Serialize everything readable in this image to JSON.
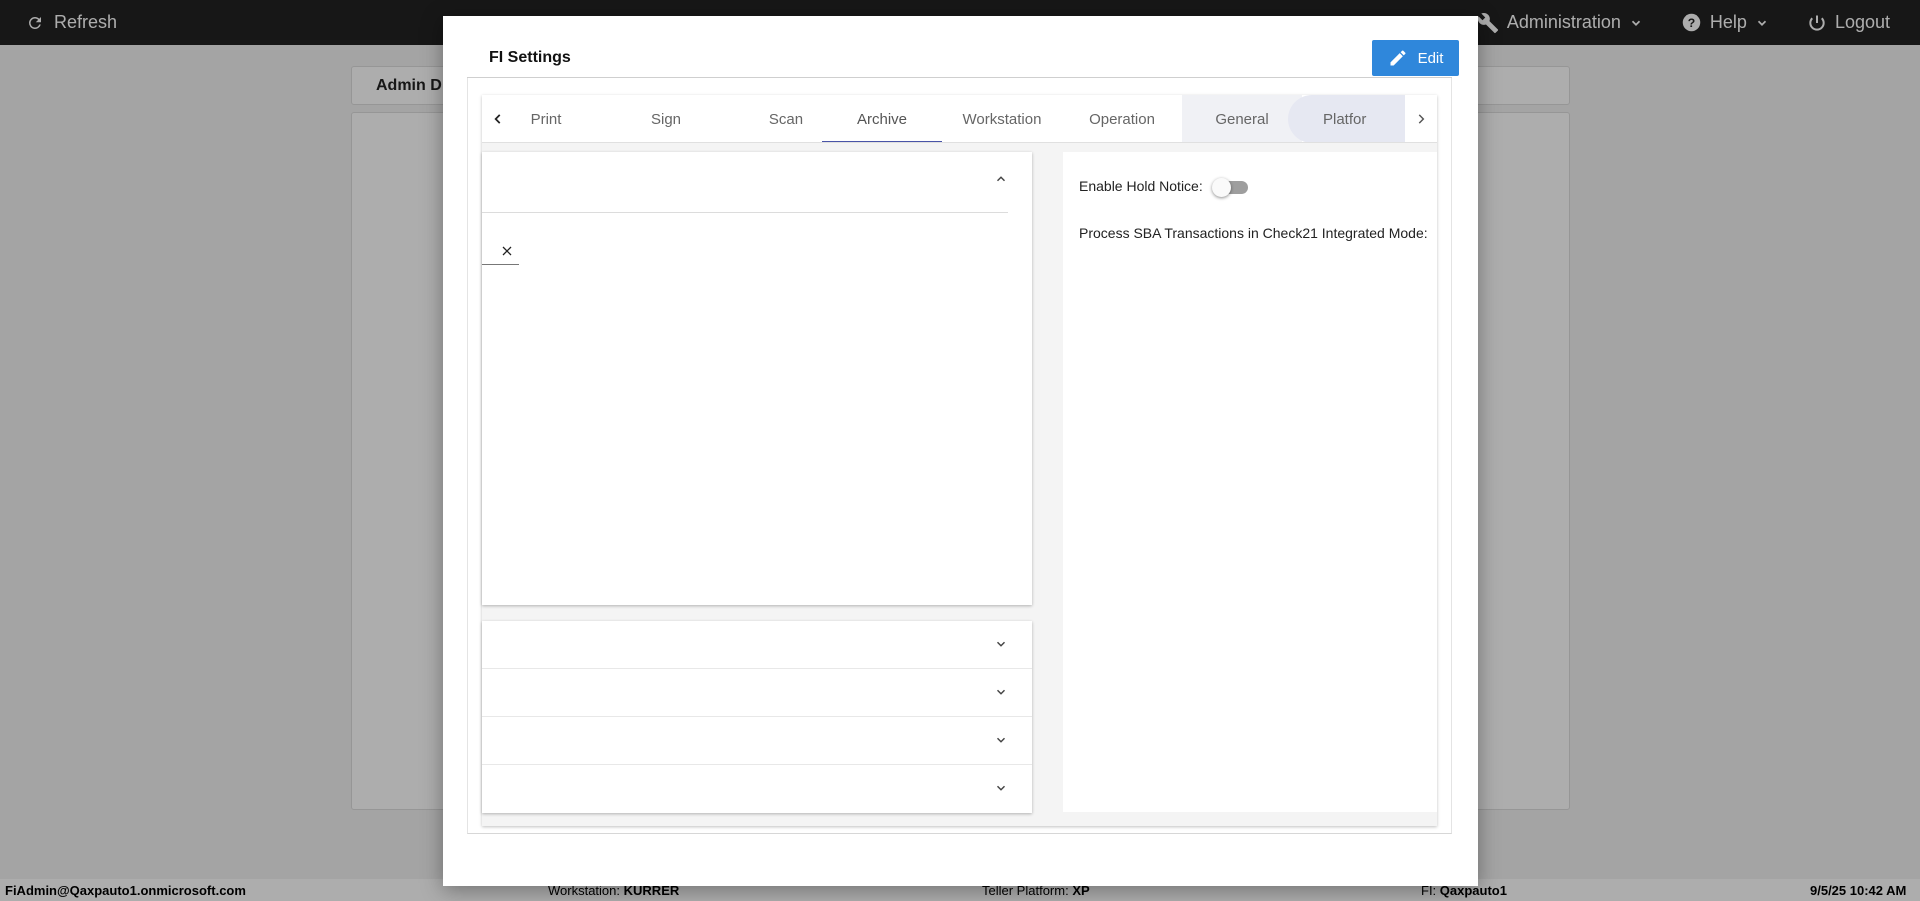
{
  "topbar": {
    "refresh_label": "Refresh",
    "nav": [
      {
        "label": "Administration",
        "icon": "wrench-icon"
      },
      {
        "label": "Help",
        "icon": "help-circle-icon"
      },
      {
        "label": "Logout",
        "icon": "power-icon"
      }
    ]
  },
  "background": {
    "admin_title": "Admin D"
  },
  "statusbar": {
    "user": "FiAdmin@Qaxpauto1.onmicrosoft.com",
    "workstation_label": "Workstation:",
    "workstation_value": "KURRER",
    "platform_label": "Teller Platform:",
    "platform_value": "XP",
    "fi_label": "FI:",
    "fi_value": "Qaxpauto1",
    "datetime": "9/5/25 10:42 AM"
  },
  "modal": {
    "title": "FI Settings",
    "edit_label": "Edit",
    "tabs": [
      {
        "label": "Print"
      },
      {
        "label": "Sign"
      },
      {
        "label": "Scan"
      },
      {
        "label": "Archive"
      },
      {
        "label": "Workstation"
      },
      {
        "label": "Operation"
      },
      {
        "label": "General"
      },
      {
        "label": "Platfor"
      }
    ],
    "active_tab": "Archive",
    "right_panel": {
      "hold_notice_label": "Enable Hold Notice:",
      "hold_notice_enabled": false,
      "sba_label": "Process SBA Transactions in Check21 Integrated Mode:"
    }
  },
  "colors": {
    "topbar": "#222222",
    "accent": "#2f87db",
    "active_tab_underline": "#4a55a8"
  }
}
